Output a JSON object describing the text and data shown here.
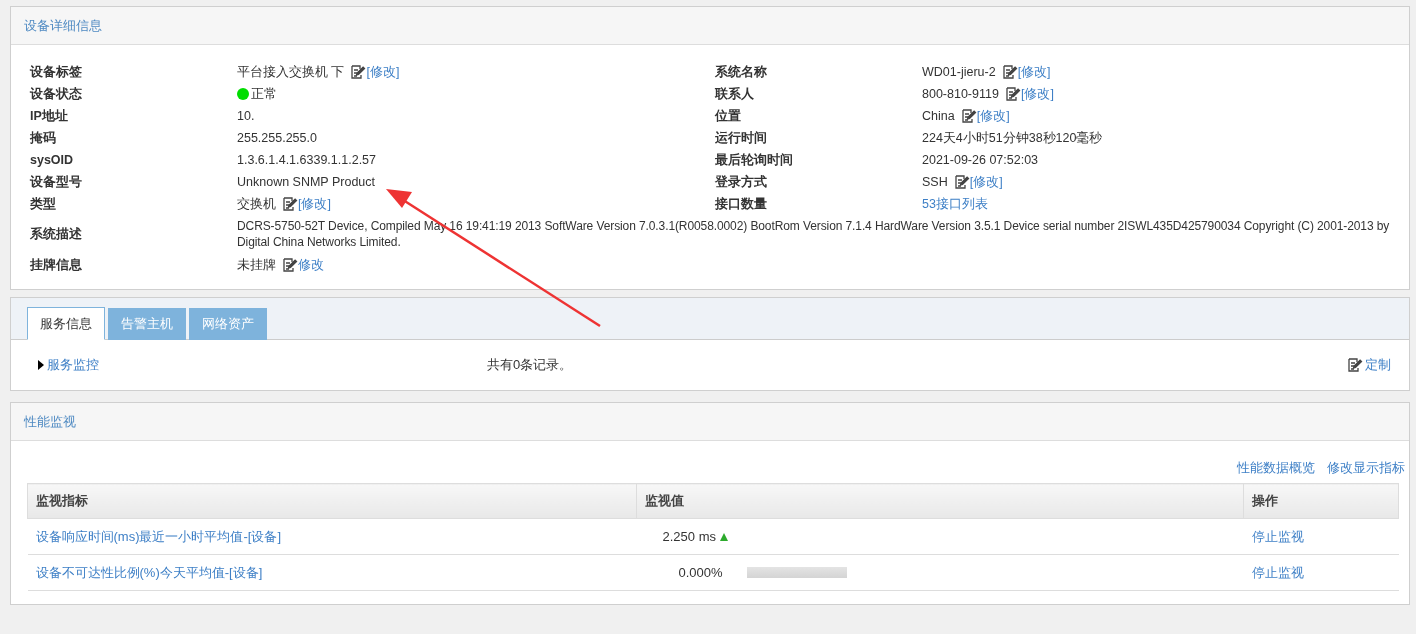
{
  "device_panel": {
    "title": "设备详细信息",
    "left": [
      {
        "kind": "edit",
        "label": "设备标签",
        "value": "平台接入交换机 下",
        "edit": "[修改]"
      },
      {
        "kind": "status",
        "label": "设备状态",
        "value": "正常",
        "color": "#00dd00"
      },
      {
        "kind": "text",
        "label": "IP地址",
        "value": "10."
      },
      {
        "kind": "text",
        "label": "掩码",
        "value": "255.255.255.0"
      },
      {
        "kind": "text",
        "label": "sysOID",
        "value": "1.3.6.1.4.1.6339.1.1.2.57"
      },
      {
        "kind": "text",
        "label": "设备型号",
        "value": "Unknown SNMP Product"
      },
      {
        "kind": "edit",
        "label": "类型",
        "value": "交换机",
        "edit": "[修改]"
      },
      {
        "kind": "desc",
        "label": "系统描述",
        "value": "DCRS-5750-52T Device, Compiled May 16 19:41:19 2013 SoftWare Version 7.0.3.1(R0058.0002) BootRom Version 7.1.4 HardWare Version 3.5.1 Device serial number 2ISWL435D425790034 Copyright (C) 2001-2013 by Digital China Networks Limited."
      },
      {
        "kind": "edit",
        "label": "挂牌信息",
        "value": "未挂牌",
        "edit": "修改"
      }
    ],
    "right": [
      {
        "kind": "edit",
        "label": "系统名称",
        "value": "WD01-jieru-2",
        "edit": "[修改]"
      },
      {
        "kind": "edit",
        "label": "联系人",
        "value": "800-810-9119",
        "edit": "[修改]"
      },
      {
        "kind": "edit",
        "label": "位置",
        "value": "China",
        "edit": "[修改]"
      },
      {
        "kind": "text",
        "label": "运行时间",
        "value": "224天4小时51分钟38秒120毫秒"
      },
      {
        "kind": "text",
        "label": "最后轮询时间",
        "value": "2021-09-26 07:52:03"
      },
      {
        "kind": "edit",
        "label": "登录方式",
        "value": "SSH",
        "edit": "[修改]"
      },
      {
        "kind": "link",
        "label": "接口数量",
        "value": "53",
        "link": "接口列表"
      }
    ]
  },
  "service_panel": {
    "tabs": [
      {
        "label": "服务信息",
        "selected": true
      },
      {
        "label": "告警主机",
        "selected": false
      },
      {
        "label": "网络资产",
        "selected": false
      }
    ],
    "expander": "服务监控",
    "expanded": false,
    "record_count": "共有0条记录。",
    "customize": "定制"
  },
  "performance_panel": {
    "title": "性能监视",
    "links": [
      "性能数据概览",
      "修改显示指标"
    ],
    "columns": [
      "监视指标",
      "监视值",
      "操作"
    ],
    "rows": [
      {
        "kind": "trend",
        "metric": "设备响应时间(ms)最近一小时平均值-[设备]",
        "value": "2.250 ms",
        "action": "停止监视"
      },
      {
        "kind": "bar",
        "metric": "设备不可达性比例(%)今天平均值-[设备]",
        "value": "0.000%",
        "level": 0,
        "action": "停止监视"
      }
    ]
  },
  "annotation": {
    "kind": "arrow"
  }
}
